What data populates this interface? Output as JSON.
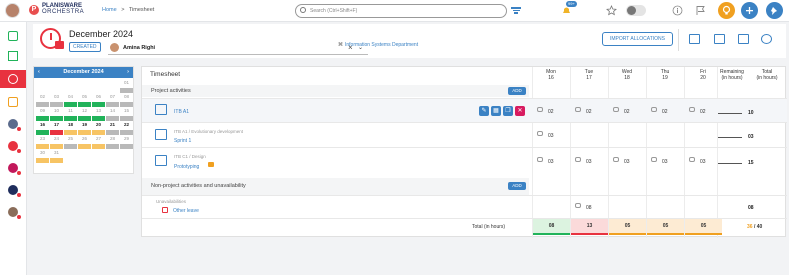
{
  "app": {
    "brand_line1": "PLANISWARE",
    "brand_line2": "ORCHESTRA",
    "logo_letter": "P"
  },
  "breadcrumb": {
    "home": "Home",
    "sep": ">",
    "current": "Timesheet"
  },
  "search": {
    "placeholder": "Search (Ctrl+Shift+F)"
  },
  "topbar": {
    "notif_count": "99+"
  },
  "header": {
    "title": "December 2024",
    "status": "CREATED",
    "user": "Amina Righi",
    "clear": "×",
    "caret": "⌄",
    "department": "Information Systems Department",
    "import_button": "IMPORT ALLOCATIONS"
  },
  "calendar": {
    "month": "December 2024",
    "prev": "‹",
    "next": "›",
    "days": [
      {
        "d": "",
        "c": ""
      },
      {
        "d": "",
        "c": ""
      },
      {
        "d": "",
        "c": ""
      },
      {
        "d": "",
        "c": ""
      },
      {
        "d": "",
        "c": ""
      },
      {
        "d": "",
        "c": ""
      },
      {
        "d": "01",
        "c": "#b9b9b9"
      },
      {
        "d": "02",
        "c": "#b9b9b9"
      },
      {
        "d": "03",
        "c": "#b9b9b9"
      },
      {
        "d": "04",
        "c": "#21b35a"
      },
      {
        "d": "05",
        "c": "#21b35a"
      },
      {
        "d": "06",
        "c": "#21b35a"
      },
      {
        "d": "07",
        "c": "#b9b9b9"
      },
      {
        "d": "08",
        "c": "#b9b9b9"
      },
      {
        "d": "09",
        "c": "#21b35a"
      },
      {
        "d": "10",
        "c": "#21b35a"
      },
      {
        "d": "11",
        "c": "#21b35a"
      },
      {
        "d": "12",
        "c": "#21b35a"
      },
      {
        "d": "13",
        "c": "#21b35a"
      },
      {
        "d": "14",
        "c": "#b9b9b9"
      },
      {
        "d": "15",
        "c": "#b9b9b9"
      },
      {
        "d": "16",
        "c": "#21b35a",
        "b": true
      },
      {
        "d": "17",
        "c": "#e8323f",
        "b": true
      },
      {
        "d": "18",
        "c": "#f7c464",
        "b": true
      },
      {
        "d": "19",
        "c": "#f7c464",
        "b": true
      },
      {
        "d": "20",
        "c": "#f7c464",
        "b": true
      },
      {
        "d": "21",
        "c": "#b9b9b9",
        "b": true
      },
      {
        "d": "22",
        "c": "#b9b9b9",
        "b": true
      },
      {
        "d": "23",
        "c": "#f7c464"
      },
      {
        "d": "24",
        "c": "#f7c464"
      },
      {
        "d": "25",
        "c": "#b9b9b9"
      },
      {
        "d": "26",
        "c": "#f7c464"
      },
      {
        "d": "27",
        "c": "#f7c464"
      },
      {
        "d": "28",
        "c": "#b9b9b9"
      },
      {
        "d": "29",
        "c": "#b9b9b9"
      },
      {
        "d": "30",
        "c": "#f7c464"
      },
      {
        "d": "31",
        "c": "#f7c464"
      },
      {
        "d": "",
        "c": ""
      },
      {
        "d": "",
        "c": ""
      },
      {
        "d": "",
        "c": ""
      },
      {
        "d": "",
        "c": ""
      },
      {
        "d": "",
        "c": ""
      }
    ]
  },
  "timesheet": {
    "title": "Timesheet",
    "columns": [
      {
        "day": "Mon",
        "num": "16"
      },
      {
        "day": "Tue",
        "num": "17"
      },
      {
        "day": "Wed",
        "num": "18"
      },
      {
        "day": "Thu",
        "num": "19"
      },
      {
        "day": "Fri",
        "num": "20"
      }
    ],
    "remaining_label_1": "Remaining",
    "remaining_label_2": "(in hours)",
    "total_label_1": "Total",
    "total_label_2": "(in hours)",
    "sections": {
      "project": "Project activities",
      "non_project": "Non-project activities and unavailability",
      "add": "ADD"
    },
    "rows": {
      "r1": {
        "path": "",
        "name": "ITB A1",
        "values": [
          "02",
          "02",
          "02",
          "02",
          "02"
        ],
        "total": "10"
      },
      "r2": {
        "path": "ITB A1 / Evolutionary development",
        "name": "Sprint 1",
        "values": [
          "03",
          "",
          "",
          "",
          ""
        ],
        "total": "03"
      },
      "r3": {
        "path": "ITB C1 / Design",
        "name": "Prototyping",
        "values": [
          "03",
          "03",
          "03",
          "03",
          "03"
        ],
        "total": "15"
      },
      "r4": {
        "path": "Unavailabilities",
        "name": "Other leave",
        "values": [
          "",
          "08",
          "",
          "",
          ""
        ],
        "total": "08"
      }
    },
    "summary": {
      "label": "Total (in hours)",
      "values": [
        "08",
        "13",
        "05",
        "05",
        "05"
      ],
      "total_done": "36",
      "total_sep": " / ",
      "total_target": "40"
    }
  }
}
